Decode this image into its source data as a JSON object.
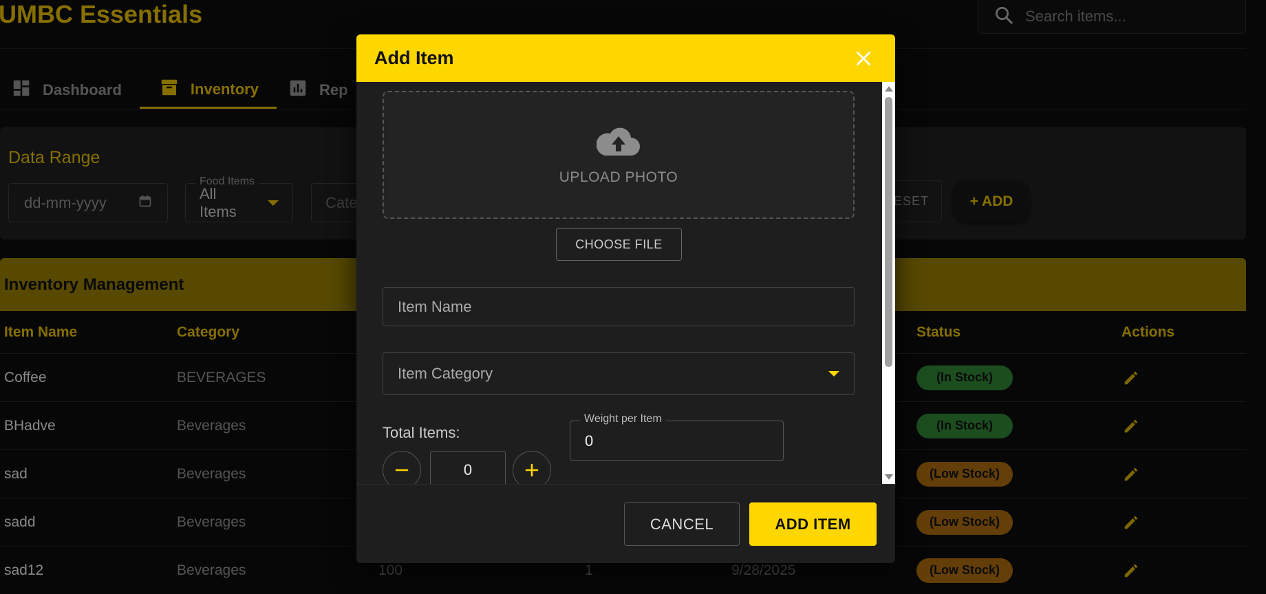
{
  "app": {
    "title": "UMBC Essentials"
  },
  "search": {
    "placeholder": "Search items..."
  },
  "nav": {
    "tabs": [
      {
        "label": "Dashboard",
        "icon": "dashboard-icon",
        "active": false
      },
      {
        "label": "Inventory",
        "icon": "inventory-icon",
        "active": true
      },
      {
        "label": "Rep",
        "icon": "reports-icon",
        "active": false
      }
    ]
  },
  "filters": {
    "title": "Data Range",
    "date_placeholder": "dd-mm-yyyy",
    "food_items_label": "Food Items",
    "food_items_value": "All Items",
    "category_placeholder": "Cate",
    "reset_label": "ESET",
    "add_label": "+ ADD"
  },
  "inventory": {
    "title": "Inventory Management",
    "columns": {
      "name": "Item Name",
      "category": "Category",
      "status": "Status",
      "actions": "Actions"
    },
    "rows": [
      {
        "name": "Coffee",
        "category": "BEVERAGES",
        "qty": "",
        "weight": "",
        "date": "",
        "status": "(In Stock)",
        "status_type": "in"
      },
      {
        "name": "BHadve",
        "category": "Beverages",
        "qty": "",
        "weight": "",
        "date": "",
        "status": "(In Stock)",
        "status_type": "in"
      },
      {
        "name": "sad",
        "category": "Beverages",
        "qty": "",
        "weight": "",
        "date": "",
        "status": "(Low Stock)",
        "status_type": "low"
      },
      {
        "name": "sadd",
        "category": "Beverages",
        "qty": "",
        "weight": "",
        "date": "",
        "status": "(Low Stock)",
        "status_type": "low"
      },
      {
        "name": "sad12",
        "category": "Beverages",
        "qty": "100",
        "weight": "1",
        "date": "9/28/2025",
        "status": "(Low Stock)",
        "status_type": "low"
      }
    ]
  },
  "modal": {
    "title": "Add Item",
    "upload_label": "UPLOAD PHOTO",
    "choose_file_label": "CHOOSE FILE",
    "item_name_placeholder": "Item Name",
    "item_category_placeholder": "Item Category",
    "total_items_label": "Total Items:",
    "total_items_value": "0",
    "weight_label": "Weight per Item",
    "weight_value": "0",
    "cancel_label": "CANCEL",
    "add_label": "ADD ITEM"
  },
  "colors": {
    "accent": "#ffd700",
    "accent_dim": "#d8b300",
    "in_stock": "#2e7d32",
    "low_stock": "#a0650e"
  }
}
